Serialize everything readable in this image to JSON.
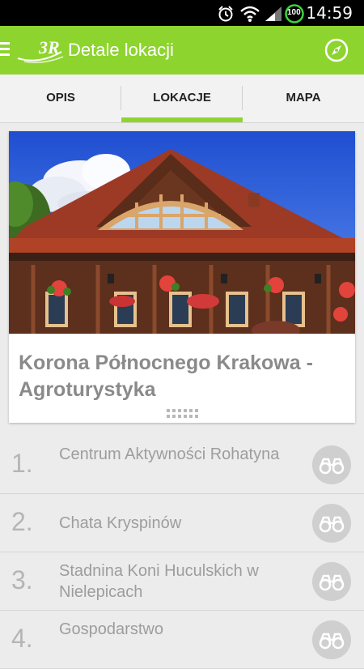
{
  "status_bar": {
    "time": "14:59",
    "battery": "100",
    "icons": [
      "alarm-clock-icon",
      "wifi-icon",
      "signal-icon",
      "battery-icon"
    ]
  },
  "app_bar": {
    "logo_text": "3R",
    "title": "Detale lokacji",
    "accent_color": "#8ed42f",
    "icons": [
      "menu-icon",
      "compass-icon"
    ]
  },
  "tabs": [
    {
      "label": "OPIS",
      "active": false
    },
    {
      "label": "LOKACJE",
      "active": true
    },
    {
      "label": "MAPA",
      "active": false
    }
  ],
  "featured": {
    "name": "Korona Północnego Krakowa - Agroturystyka"
  },
  "locations": [
    {
      "number": "1.",
      "name": "Centrum Aktywności Rohatyna"
    },
    {
      "number": "2.",
      "name": "Chata Kryspinów"
    },
    {
      "number": "3.",
      "name": "Stadnina Koni Huculskich w Nielepicach"
    },
    {
      "number": "4.",
      "name": "Gospodarstwo"
    }
  ]
}
